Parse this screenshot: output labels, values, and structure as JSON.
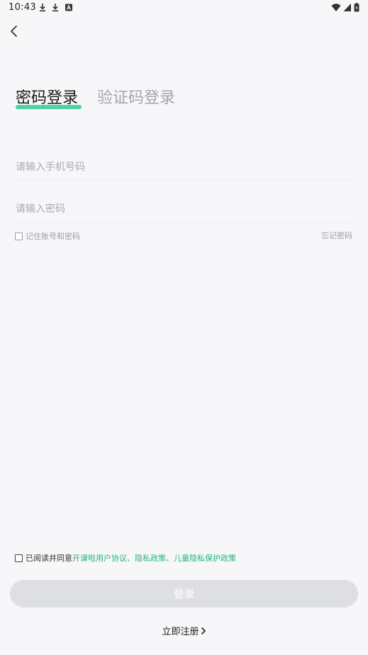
{
  "status_bar": {
    "time": "10:43",
    "left_icons": [
      "download-icon",
      "download-icon",
      "a-letter-icon"
    ],
    "right_icons": [
      "wifi-icon",
      "signal-icon",
      "battery-icon"
    ]
  },
  "header": {
    "back_icon": "chevron-left-icon"
  },
  "tabs": [
    {
      "label": "密码登录",
      "active": true
    },
    {
      "label": "验证码登录",
      "active": false
    }
  ],
  "form": {
    "phone_placeholder": "请输入手机号码",
    "password_placeholder": "请输入密码",
    "remember_label": "记住账号和密码",
    "forgot_label": "忘记密码"
  },
  "agreement": {
    "prefix": "已阅读并同意",
    "links": [
      "开课啦用户协议",
      "隐私政策",
      "儿童隐私保护政策"
    ],
    "separators": [
      "、",
      "、"
    ]
  },
  "actions": {
    "login_label": "登录",
    "register_label": "立即注册",
    "register_icon": "chevron-right-icon"
  },
  "colors": {
    "accent_green": "#22b57a",
    "tab_underline": "#4fd3a3",
    "button_disabled": "#dedfe3",
    "background": "#f7f7f9",
    "placeholder": "#a8abb2"
  }
}
